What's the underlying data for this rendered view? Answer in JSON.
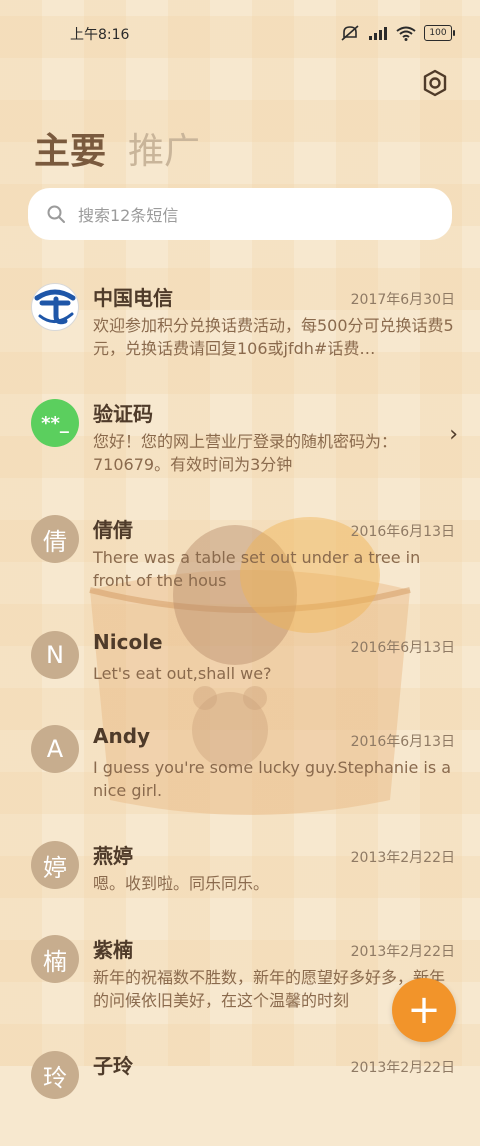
{
  "status_bar": {
    "time": "上午8:16",
    "battery": "100"
  },
  "tabs": [
    {
      "label": "主要"
    },
    {
      "label": "推广"
    }
  ],
  "search": {
    "placeholder": "搜索12条短信"
  },
  "conversations": [
    {
      "name": "中国电信",
      "date": "2017年6月30日",
      "preview": "欢迎参加积分兑换话费活动，每500分可兑换话费5元，兑换话费请回复106或jfdh#话费…",
      "avatar_text": ""
    },
    {
      "name": "验证码",
      "date": "",
      "preview": "您好！您的网上营业厅登录的随机密码为：710679。有效时间为3分钟",
      "avatar_text": "**_"
    },
    {
      "name": "倩倩",
      "date": "2016年6月13日",
      "preview": "There was a table set out under a tree in front of the hous",
      "avatar_text": "倩"
    },
    {
      "name": "Nicole",
      "date": "2016年6月13日",
      "preview": "Let's eat out,shall we?",
      "avatar_text": "N"
    },
    {
      "name": "Andy",
      "date": "2016年6月13日",
      "preview": "I guess you're some lucky guy.Stephanie is a nice girl.",
      "avatar_text": "A"
    },
    {
      "name": "燕婷",
      "date": "2013年2月22日",
      "preview": "嗯。收到啦。同乐同乐。",
      "avatar_text": "婷"
    },
    {
      "name": "紫楠",
      "date": "2013年2月22日",
      "preview": "新年的祝福数不胜数，新年的愿望好多好多，新年的问候依旧美好，在这个温馨的时刻",
      "avatar_text": "楠"
    },
    {
      "name": "子玲",
      "date": "2013年2月22日",
      "preview": "",
      "avatar_text": "玲"
    }
  ],
  "fab": {
    "label": "+"
  },
  "colors": {
    "accent": "#f2942a",
    "verify_avatar": "#5bcf5e",
    "telecom_blue": "#1e56a8"
  }
}
